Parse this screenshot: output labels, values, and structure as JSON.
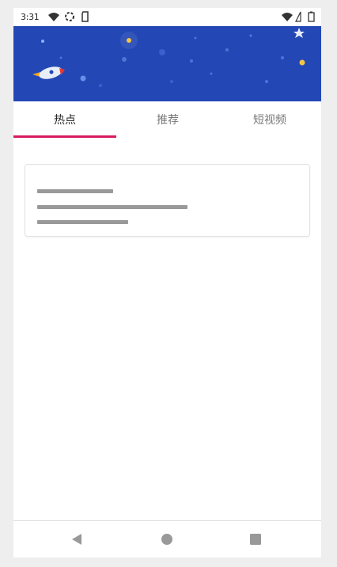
{
  "status_bar": {
    "time": "3:31"
  },
  "tabs": [
    {
      "label": "热点",
      "active": true
    },
    {
      "label": "推荐",
      "active": false
    },
    {
      "label": "短视频",
      "active": false
    }
  ],
  "colors": {
    "banner": "#2348b5",
    "tab_indicator": "#d81b60",
    "skeleton": "#999999"
  },
  "nav_bar": {
    "icons": [
      "back-triangle-icon",
      "home-circle-icon",
      "recents-square-icon"
    ]
  }
}
